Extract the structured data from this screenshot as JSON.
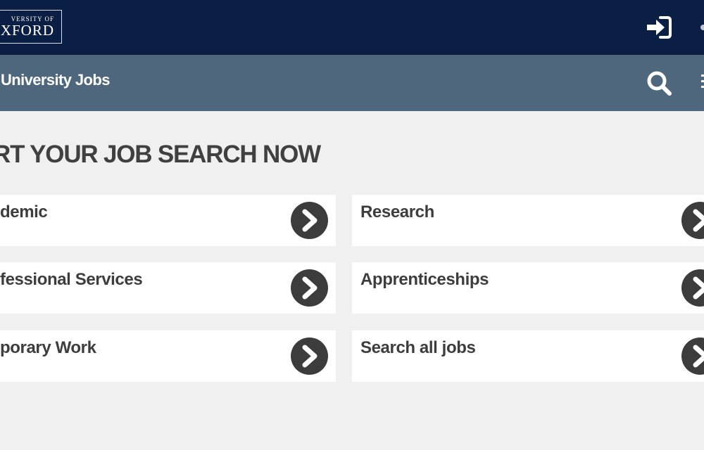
{
  "header": {
    "logo": {
      "line1": "VERSITY OF",
      "line2": "XFORD"
    },
    "sign_in_icon": "sign-in-arrow-icon"
  },
  "navbar": {
    "title": "University Jobs",
    "search_icon": "search-icon",
    "menu_icon": "hamburger-menu-icon"
  },
  "main": {
    "heading": "RT YOUR JOB SEARCH NOW",
    "categories": [
      {
        "label": "demic",
        "icon": "chevron-right-circle-icon"
      },
      {
        "label": "Research",
        "icon": "chevron-right-circle-icon"
      },
      {
        "label": "fessional Services",
        "icon": "chevron-right-circle-icon"
      },
      {
        "label": "Apprenticeships",
        "icon": "chevron-right-circle-icon"
      },
      {
        "label": "porary Work",
        "icon": "chevron-right-circle-icon"
      },
      {
        "label": "Search all jobs",
        "icon": "chevron-right-circle-icon"
      }
    ]
  },
  "colors": {
    "header_bg": "#0b1f45",
    "navbar_bg": "#4e677d",
    "page_bg": "#f0f0f0",
    "card_bg": "#ffffff",
    "text_dark": "#3d3d3d",
    "arrow_circle": "#3c3c3c"
  }
}
